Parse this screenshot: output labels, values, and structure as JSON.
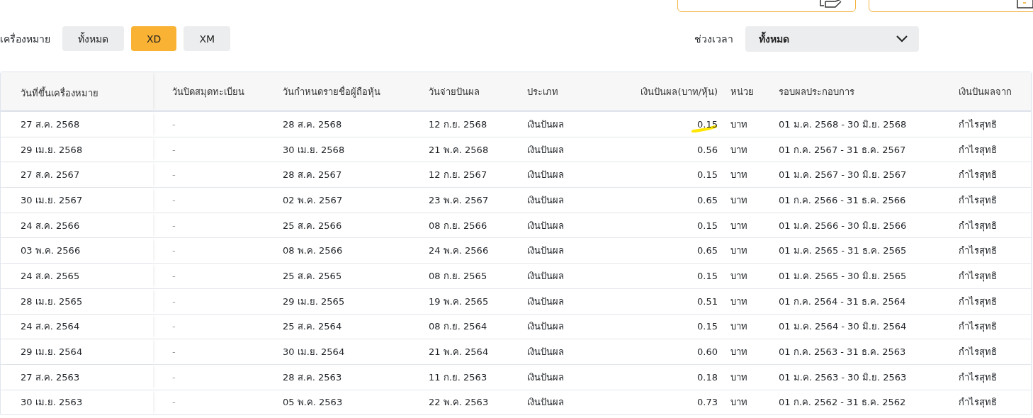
{
  "top_actions": [
    {
      "kind": "sign"
    },
    {
      "kind": "doc"
    }
  ],
  "filters": {
    "label": "เครื่องหมาย",
    "options": [
      {
        "label": "ทั้งหมด",
        "selected": false
      },
      {
        "label": "XD",
        "selected": true
      },
      {
        "label": "XM",
        "selected": false
      }
    ]
  },
  "period": {
    "label": "ช่วงเวลา",
    "value": "ทั้งหมด"
  },
  "table": {
    "columns": [
      "วันที่ขึ้นเครื่องหมาย",
      "วันปิดสมุดทะเบียน",
      "วันกำหนดรายชื่อผู้ถือหุ้น",
      "วันจ่ายปันผล",
      "ประเภท",
      "เงินปันผล(บาท/หุ้น)",
      "หน่วย",
      "รอบผลประกอบการ",
      "เงินปันผลจาก"
    ],
    "rows": [
      {
        "cells": [
          "27 ส.ค. 2568",
          "-",
          "28 ส.ค. 2568",
          "12 ก.ย. 2568",
          "เงินปันผล",
          "0.15",
          "บาท",
          "01 ม.ค. 2568 - 30 มิ.ย. 2568",
          "กำไรสุทธิ"
        ],
        "highlighted": true
      },
      {
        "cells": [
          "29 เม.ย. 2568",
          "-",
          "30 เม.ย. 2568",
          "21 พ.ค. 2568",
          "เงินปันผล",
          "0.56",
          "บาท",
          "01 ก.ค. 2567 - 31 ธ.ค. 2567",
          "กำไรสุทธิ"
        ],
        "highlighted": false
      },
      {
        "cells": [
          "27 ส.ค. 2567",
          "-",
          "28 ส.ค. 2567",
          "12 ก.ย. 2567",
          "เงินปันผล",
          "0.15",
          "บาท",
          "01 ม.ค. 2567 - 30 มิ.ย. 2567",
          "กำไรสุทธิ"
        ],
        "highlighted": false
      },
      {
        "cells": [
          "30 เม.ย. 2567",
          "-",
          "02 พ.ค. 2567",
          "23 พ.ค. 2567",
          "เงินปันผล",
          "0.65",
          "บาท",
          "01 ก.ค. 2566 - 31 ธ.ค. 2566",
          "กำไรสุทธิ"
        ],
        "highlighted": false
      },
      {
        "cells": [
          "24 ส.ค. 2566",
          "-",
          "25 ส.ค. 2566",
          "08 ก.ย. 2566",
          "เงินปันผล",
          "0.15",
          "บาท",
          "01 ม.ค. 2566 - 30 มิ.ย. 2566",
          "กำไรสุทธิ"
        ],
        "highlighted": false
      },
      {
        "cells": [
          "03 พ.ค. 2566",
          "-",
          "08 พ.ค. 2566",
          "24 พ.ค. 2566",
          "เงินปันผล",
          "0.65",
          "บาท",
          "01 ม.ค. 2565 - 31 ธ.ค. 2565",
          "กำไรสุทธิ"
        ],
        "highlighted": false
      },
      {
        "cells": [
          "24 ส.ค. 2565",
          "-",
          "25 ส.ค. 2565",
          "08 ก.ย. 2565",
          "เงินปันผล",
          "0.15",
          "บาท",
          "01 ม.ค. 2565 - 30 มิ.ย. 2565",
          "กำไรสุทธิ"
        ],
        "highlighted": false
      },
      {
        "cells": [
          "28 เม.ย. 2565",
          "-",
          "29 เม.ย. 2565",
          "19 พ.ค. 2565",
          "เงินปันผล",
          "0.51",
          "บาท",
          "01 ก.ค. 2564 - 31 ธ.ค. 2564",
          "กำไรสุทธิ"
        ],
        "highlighted": false
      },
      {
        "cells": [
          "24 ส.ค. 2564",
          "-",
          "25 ส.ค. 2564",
          "08 ก.ย. 2564",
          "เงินปันผล",
          "0.15",
          "บาท",
          "01 ม.ค. 2564 - 30 มิ.ย. 2564",
          "กำไรสุทธิ"
        ],
        "highlighted": false
      },
      {
        "cells": [
          "29 เม.ย. 2564",
          "-",
          "30 เม.ย. 2564",
          "21 พ.ค. 2564",
          "เงินปันผล",
          "0.60",
          "บาท",
          "01 ก.ค. 2563 - 31 ธ.ค. 2563",
          "กำไรสุทธิ"
        ],
        "highlighted": false
      },
      {
        "cells": [
          "27 ส.ค. 2563",
          "-",
          "28 ส.ค. 2563",
          "11 ก.ย. 2563",
          "เงินปันผล",
          "0.18",
          "บาท",
          "01 ม.ค. 2563 - 30 มิ.ย. 2563",
          "กำไรสุทธิ"
        ],
        "highlighted": false
      },
      {
        "cells": [
          "30 เม.ย. 2563",
          "-",
          "05 พ.ค. 2563",
          "22 พ.ค. 2563",
          "เงินปันผล",
          "0.73",
          "บาท",
          "01 ก.ค. 2562 - 31 ธ.ค. 2562",
          "กำไรสุทธิ"
        ],
        "highlighted": false
      }
    ]
  }
}
